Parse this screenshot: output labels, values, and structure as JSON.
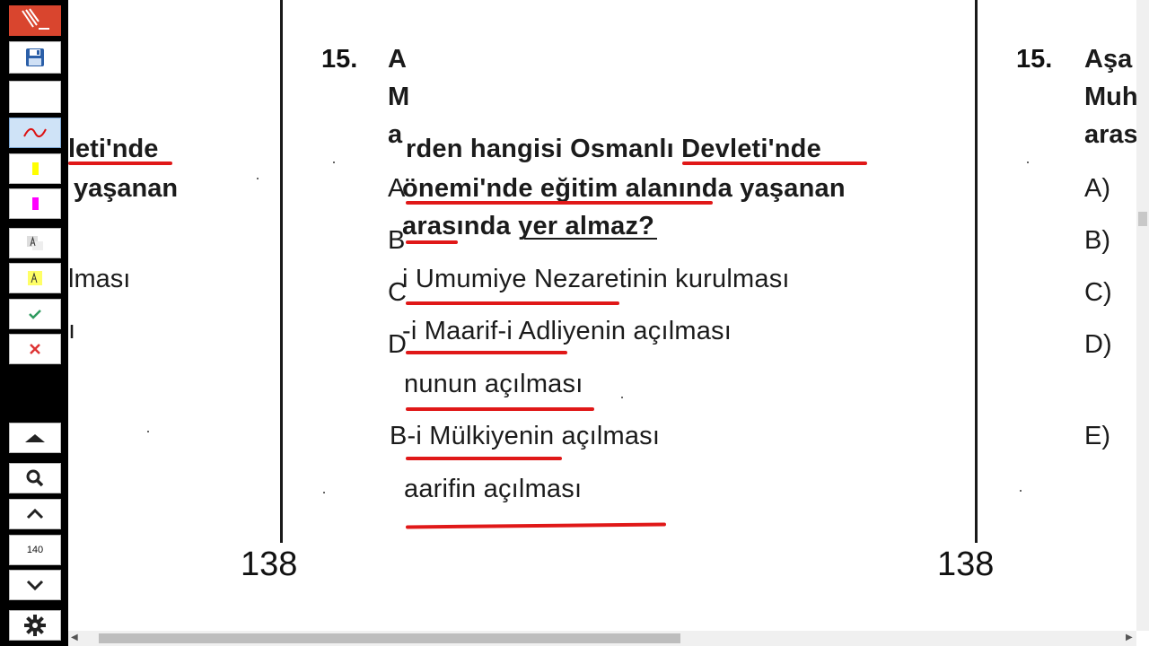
{
  "toolbar": {
    "zoom_value": "140"
  },
  "page": {
    "question_number": "15.",
    "left_fragments": {
      "line1": "leti'nde",
      "line2": "yaşanan",
      "line3": "lması",
      "line4": "ı"
    },
    "center_margin_letters": [
      "A",
      "M",
      "a",
      "A",
      "B",
      "C",
      "D"
    ],
    "center_lines": {
      "q1": "rden hangisi Osmanlı Devleti'nde",
      "q2": "önemi'nde eğitim alanında yaşanan",
      "q3": "arasında yer almaz?",
      "opt_a": "i Umumiye Nezaretinin kurulması",
      "opt_b": "-i Maarif-i Adliyenin açılması",
      "opt_c": "nunun açılması",
      "opt_d": "B-i Mülkiyenin açılması",
      "opt_e": "aarifin açılması"
    },
    "right_lines": {
      "l1": "Aşa",
      "l2": "Muh",
      "l3": "aras"
    },
    "right_options": [
      "A)",
      "B)",
      "C)",
      "D)",
      "E)"
    ],
    "page_number": "138"
  },
  "colors": {
    "annotation_red": "#e01818",
    "highlight_yellow": "#ffff00",
    "highlight_magenta": "#ff00ff",
    "toolbar_bg": "#000000",
    "app_red": "#d9452e"
  }
}
